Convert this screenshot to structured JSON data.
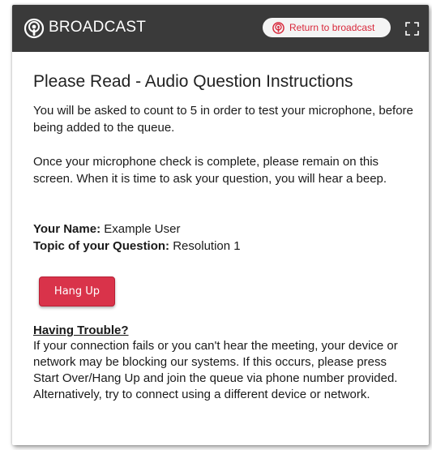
{
  "header": {
    "title": "BROADCAST",
    "return_label": "Return to broadcast",
    "background": "#3a3a3a",
    "accent": "#d8283b",
    "icons": [
      "podcast-icon",
      "fullscreen-icon"
    ]
  },
  "main": {
    "title": "Please Read - Audio Question Instructions",
    "paragraph1": "You will be asked to count to 5 in order to test your microphone, before being added to the queue.",
    "paragraph2": "Once your microphone check is complete, please remain on this screen. When it is time to ask your question, you will hear a beep.",
    "name_label": "Your Name:",
    "name_value": "Example User",
    "topic_label": "Topic of your Question:",
    "topic_value": "Resolution 1",
    "hangup_label": "Hang Up",
    "hangup_color": "#d9334a",
    "trouble_heading": "Having Trouble?",
    "trouble_text": "If your connection fails or you can't hear the meeting, your device or network may be blocking our systems. If this occurs, please press Start Over/Hang Up and join the queue via phone number provided. Alternatively, try to connect using a different device or network."
  }
}
